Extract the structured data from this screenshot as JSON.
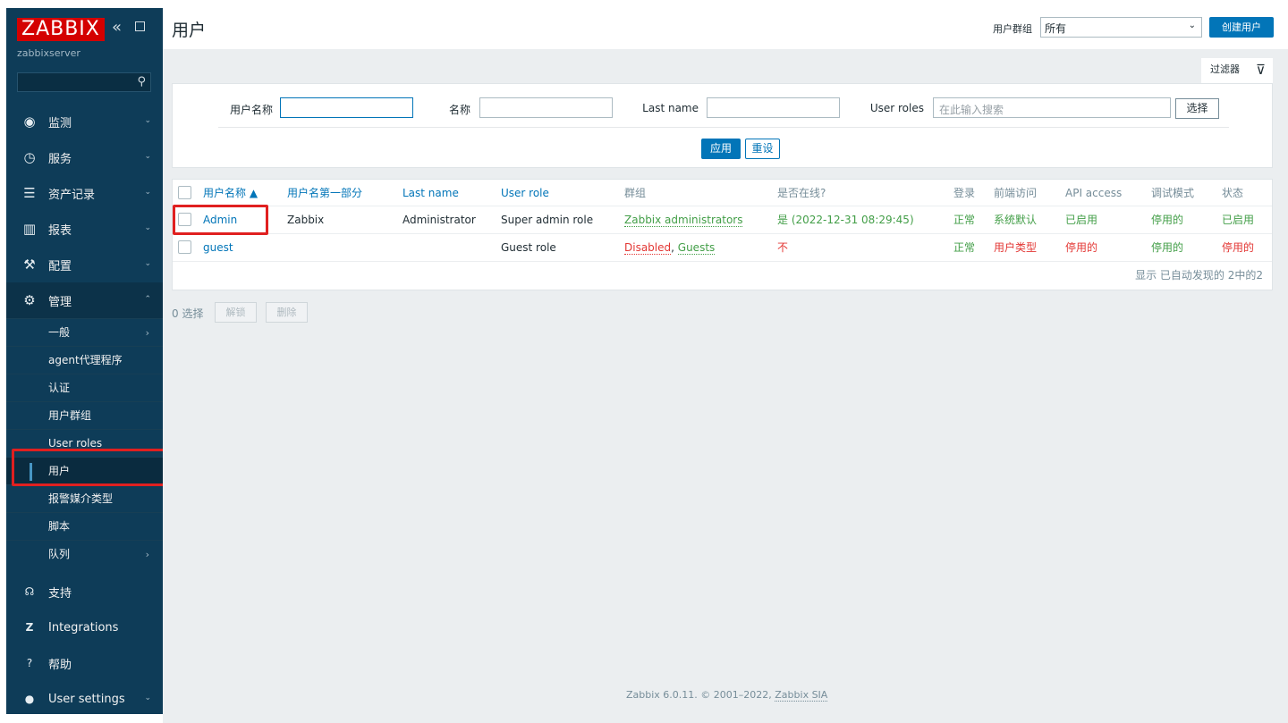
{
  "brand": {
    "logo": "ZABBIX",
    "server": "zabbixserver"
  },
  "sidebar": {
    "menu": [
      {
        "label": "监测",
        "icon": "eye-icon"
      },
      {
        "label": "服务",
        "icon": "clock-icon"
      },
      {
        "label": "资产记录",
        "icon": "list-icon"
      },
      {
        "label": "报表",
        "icon": "chart-icon"
      },
      {
        "label": "配置",
        "icon": "wrench-icon"
      },
      {
        "label": "管理",
        "icon": "gear-icon"
      }
    ],
    "admin_submenu": [
      "一般",
      "agent代理程序",
      "认证",
      "用户群组",
      "User roles",
      "用户",
      "报警媒介类型",
      "脚本",
      "队列"
    ],
    "bottom": [
      {
        "label": "支持",
        "icon": "headset-icon"
      },
      {
        "label": "Integrations",
        "icon": "zabbix-z-icon"
      },
      {
        "label": "帮助",
        "icon": "question-icon"
      },
      {
        "label": "User settings",
        "icon": "user-icon"
      }
    ]
  },
  "header": {
    "title": "用户",
    "group_label": "用户群组",
    "group_value": "所有",
    "create_button": "创建用户"
  },
  "filter": {
    "tab_label": "过滤器",
    "username_label": "用户名称",
    "name_label": "名称",
    "lastname_label": "Last name",
    "roles_label": "User roles",
    "roles_placeholder": "在此输入搜索",
    "select_button": "选择",
    "apply": "应用",
    "reset": "重设"
  },
  "table": {
    "columns": [
      "用户名称 ▲",
      "用户名第一部分",
      "Last name",
      "User role",
      "群组",
      "是否在线?",
      "登录",
      "前端访问",
      "API access",
      "调试模式",
      "状态"
    ],
    "rows": [
      {
        "username": "Admin",
        "name": "Zabbix",
        "lastname": "Administrator",
        "role": "Super admin role",
        "groups": [
          "Zabbix administrators"
        ],
        "online": "是 (2022-12-31 08:29:45)",
        "login": "正常",
        "frontend": "系统默认",
        "api": "已启用",
        "debug": "停用的",
        "status": "已启用"
      },
      {
        "username": "guest",
        "name": "",
        "lastname": "",
        "role": "Guest role",
        "groups": [
          "Disabled",
          "Guests"
        ],
        "online": "不",
        "login": "正常",
        "frontend": "用户类型",
        "api": "停用的",
        "debug": "停用的",
        "status": "停用的"
      }
    ],
    "footer": "显示 已自动发现的 2中的2"
  },
  "mass": {
    "selected": "0 选择",
    "unblock": "解锁",
    "delete": "删除"
  },
  "footer": {
    "text": "Zabbix 6.0.11. © 2001–2022, ",
    "link": "Zabbix SIA"
  },
  "colors": {
    "sidebar": "#0e3c58",
    "brand": "#d40000",
    "accent": "#0275b8",
    "ok": "#429e47",
    "bad": "#e33734",
    "highlight": "#e02020"
  }
}
